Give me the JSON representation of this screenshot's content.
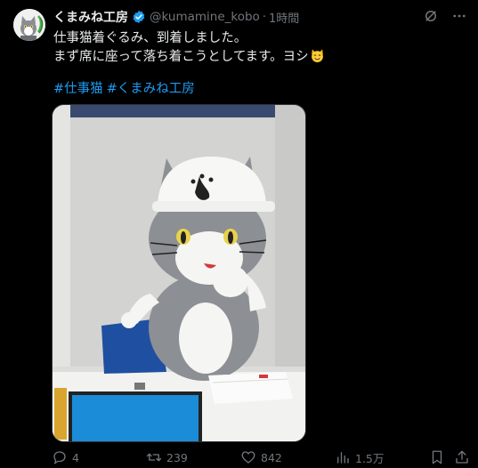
{
  "post": {
    "author": {
      "display_name": "くまみね工房",
      "handle": "@kumamine_kobo",
      "verified": true,
      "avatar": "cat-mascot-avatar"
    },
    "separator": "·",
    "time": "1時間",
    "text_lines": [
      "仕事猫着ぐるみ、到着しました。",
      "まず席に座って落ち着こうとしてます。ヨシ"
    ],
    "emoji": "cat-face-emoji",
    "hashtags": [
      "#仕事猫",
      "#くまみね工房"
    ],
    "media": {
      "type": "photo",
      "description_icon": "cat-costume-photo"
    },
    "top_actions": [
      "grok-icon",
      "more-icon"
    ],
    "stats": {
      "replies": "4",
      "reposts": "239",
      "likes": "842",
      "views": "1.5万"
    },
    "colors": {
      "background": "#000000",
      "text": "#e7e9ea",
      "muted": "#71767b",
      "link": "#1d9bf0",
      "verified": "#1d9bf0"
    }
  }
}
